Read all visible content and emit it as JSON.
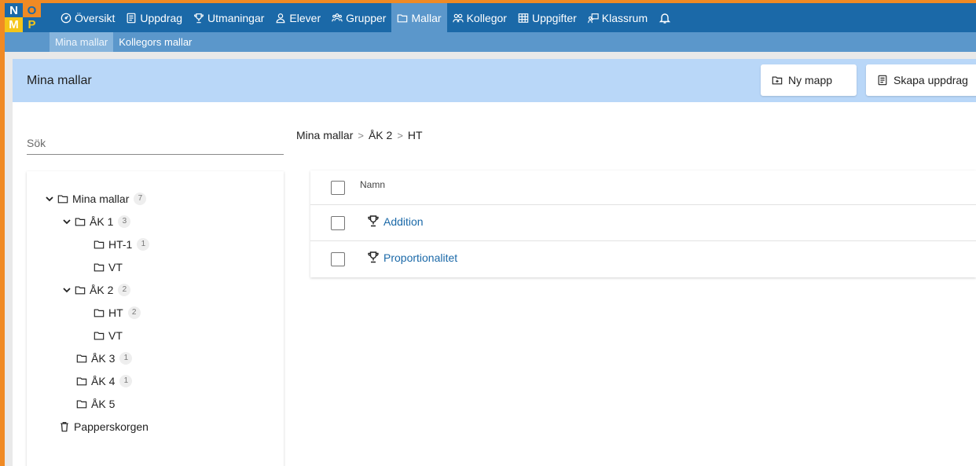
{
  "logo": {
    "letters": [
      "N",
      "O",
      "M",
      "P"
    ]
  },
  "nav": {
    "items": [
      {
        "label": "Översikt",
        "icon": "dashboard-icon",
        "active": false
      },
      {
        "label": "Uppdrag",
        "icon": "document-icon",
        "active": false
      },
      {
        "label": "Utmaningar",
        "icon": "trophy-icon",
        "active": false
      },
      {
        "label": "Elever",
        "icon": "person-icon",
        "active": false
      },
      {
        "label": "Grupper",
        "icon": "group-icon",
        "active": false
      },
      {
        "label": "Mallar",
        "icon": "folder-icon",
        "active": true
      },
      {
        "label": "Kollegor",
        "icon": "colleagues-icon",
        "active": false
      },
      {
        "label": "Uppgifter",
        "icon": "grid-icon",
        "active": false
      },
      {
        "label": "Klassrum",
        "icon": "classroom-icon",
        "active": false
      }
    ],
    "bell_icon": "bell-icon"
  },
  "subnav": {
    "items": [
      {
        "label": "Mina mallar",
        "active": true
      },
      {
        "label": "Kollegors mallar",
        "active": false
      }
    ]
  },
  "header": {
    "title": "Mina mallar",
    "new_folder_label": "Ny mapp",
    "create_label": "Skapa uppdrag"
  },
  "search": {
    "placeholder": "Sök"
  },
  "tree": {
    "root": {
      "label": "Mina mallar",
      "count": "7"
    },
    "ak1": {
      "label": "ÅK 1",
      "count": "3"
    },
    "ak1_ht1": {
      "label": "HT-1",
      "count": "1"
    },
    "ak1_vt": {
      "label": "VT"
    },
    "ak2": {
      "label": "ÅK 2",
      "count": "2"
    },
    "ak2_ht": {
      "label": "HT",
      "count": "2"
    },
    "ak2_vt": {
      "label": "VT"
    },
    "ak3": {
      "label": "ÅK 3",
      "count": "1"
    },
    "ak4": {
      "label": "ÅK 4",
      "count": "1"
    },
    "ak5": {
      "label": "ÅK 5"
    },
    "trash": {
      "label": "Papperskorgen"
    }
  },
  "breadcrumb": {
    "items": [
      "Mina mallar",
      "ÅK 2",
      "HT"
    ],
    "separator": ">"
  },
  "table": {
    "header": "Namn",
    "rows": [
      {
        "name": "Addition"
      },
      {
        "name": "Proportionalitet"
      }
    ]
  },
  "colors": {
    "primary": "#1b69a8",
    "active_nav": "#5b97cb",
    "header_bg": "#b9d7f8",
    "accent_orange": "#f08a24",
    "accent_yellow": "#f5c518"
  }
}
